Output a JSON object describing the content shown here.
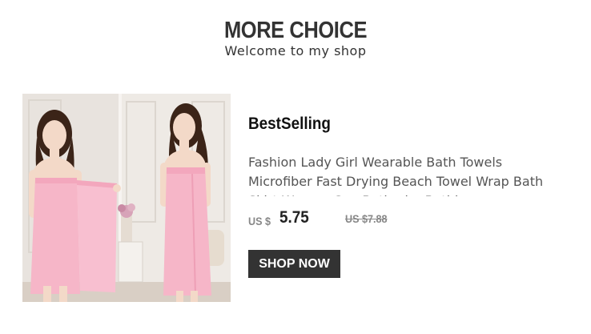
{
  "header": {
    "title": "MORE CHOICE",
    "subtitle": "Welcome to my shop"
  },
  "product": {
    "section_label": "BestSelling",
    "title": "Fashion Lady Girl Wearable Bath Towels Microfiber Fast Drying Beach Towel Wrap Bath Skirt Women Spa Bathrobe Bathing",
    "currency": "US $",
    "price": "5.75",
    "old_price": "US $7.88",
    "button_label": "SHOP NOW",
    "image_icon": "product-photo"
  },
  "colors": {
    "button_bg": "#333333",
    "towel_pink": "#f6b6c8",
    "text_dark": "#333333"
  }
}
